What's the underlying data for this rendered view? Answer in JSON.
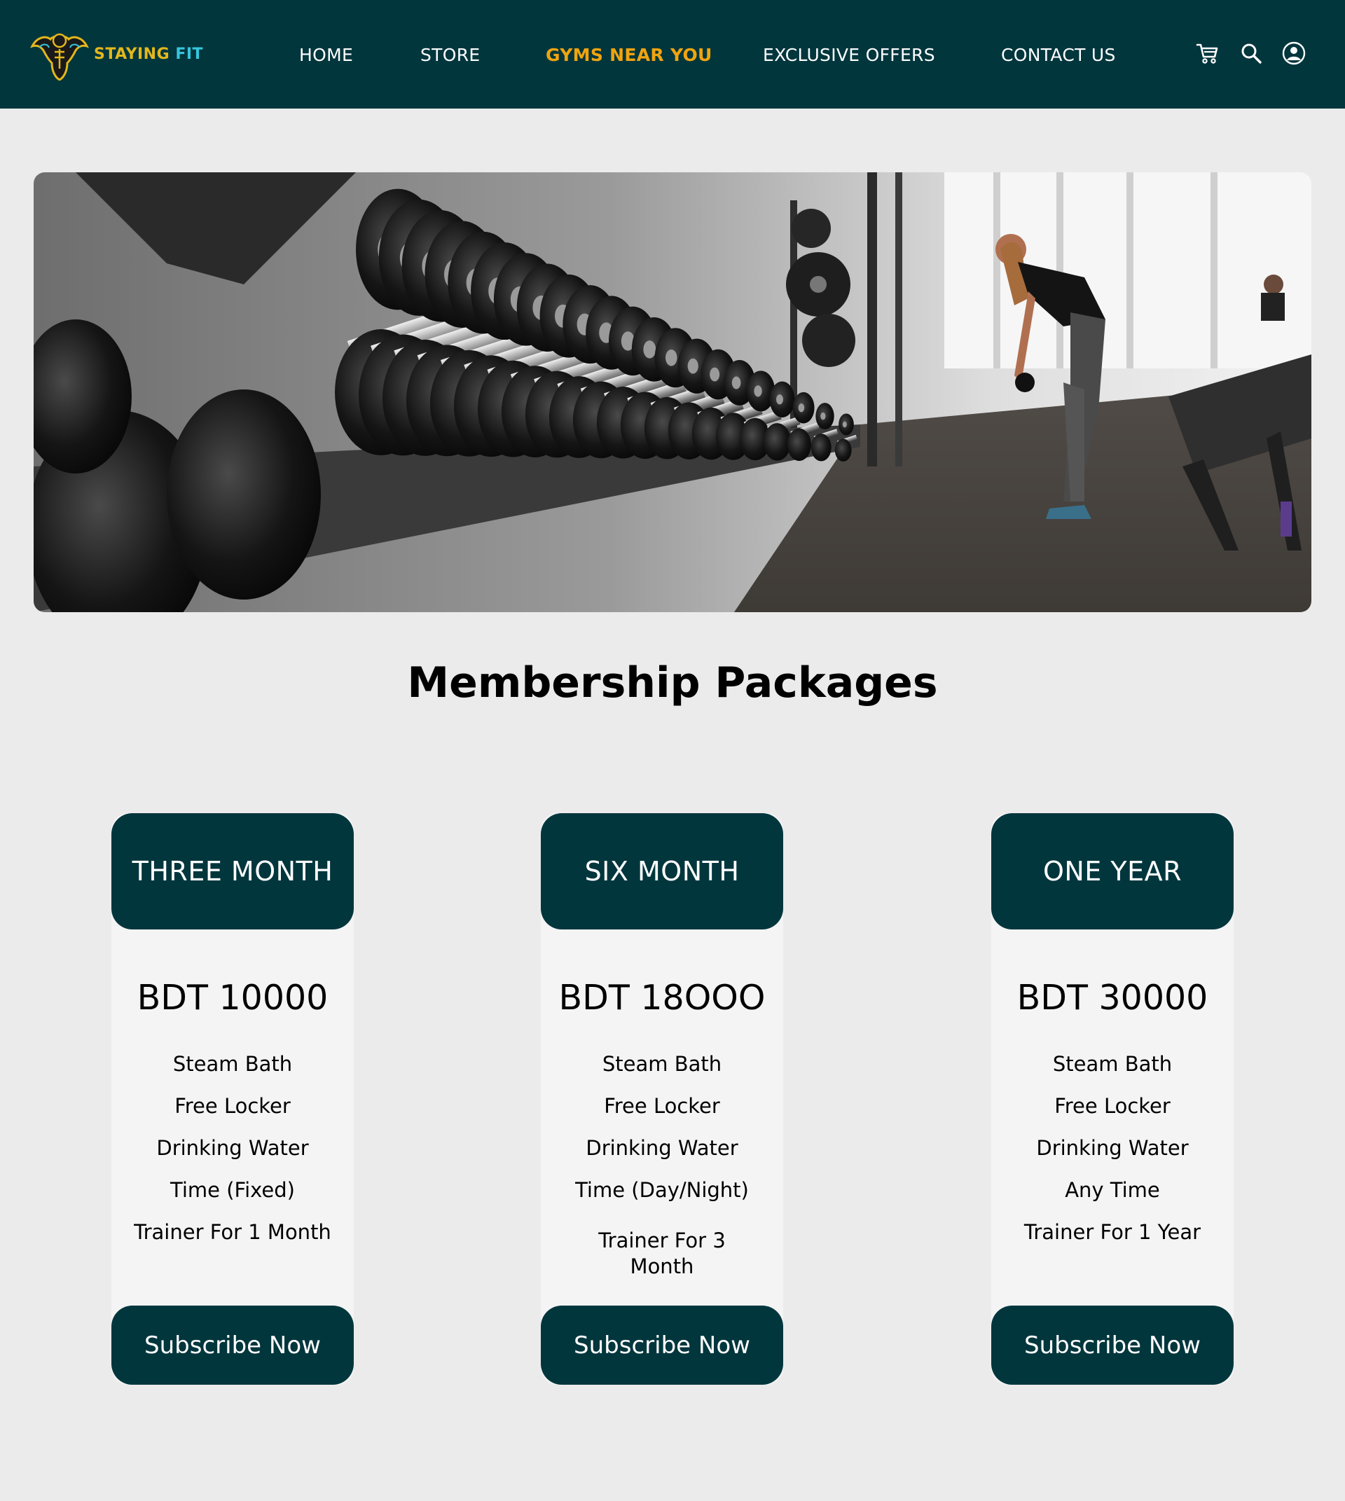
{
  "brand": {
    "name_part1": "STAYING",
    "name_part2": "FIT",
    "logo_icon": "muscle-man-icon"
  },
  "nav": {
    "links": [
      {
        "label": "HOME",
        "active": false
      },
      {
        "label": "STORE",
        "active": false
      },
      {
        "label": "GYMS NEAR YOU",
        "active": true
      },
      {
        "label": "EXCLUSIVE OFFERS",
        "active": false
      },
      {
        "label": "CONTACT US",
        "active": false
      }
    ],
    "icons": [
      "cart-icon",
      "search-icon",
      "user-icon"
    ]
  },
  "hero": {
    "image": "gym-dumbbell-rack-photo"
  },
  "section": {
    "title": "Membership Packages"
  },
  "packages": [
    {
      "name": "THREE MONTH",
      "price": "BDT 10000",
      "features": [
        "Steam Bath",
        "Free Locker",
        "Drinking Water",
        "Time (Fixed)",
        "Trainer For 1 Month"
      ],
      "cta": "Subscribe Now"
    },
    {
      "name": "SIX MONTH",
      "price": "BDT 18OOO",
      "features": [
        "Steam Bath",
        "Free Locker",
        "Drinking Water",
        "Time (Day/Night)",
        "Trainer For 3 Month"
      ],
      "cta": "Subscribe Now"
    },
    {
      "name": "ONE YEAR",
      "price": "BDT 30000",
      "features": [
        "Steam Bath",
        "Free Locker",
        "Drinking Water",
        "Any Time",
        "Trainer For 1 Year"
      ],
      "cta": "Subscribe Now"
    }
  ],
  "colors": {
    "primary": "#02363d",
    "accent": "#f0a40f",
    "brand_yellow": "#e3b81c",
    "brand_cyan": "#36c6dc",
    "background": "#ebebeb",
    "card_background": "#f4f4f4"
  }
}
